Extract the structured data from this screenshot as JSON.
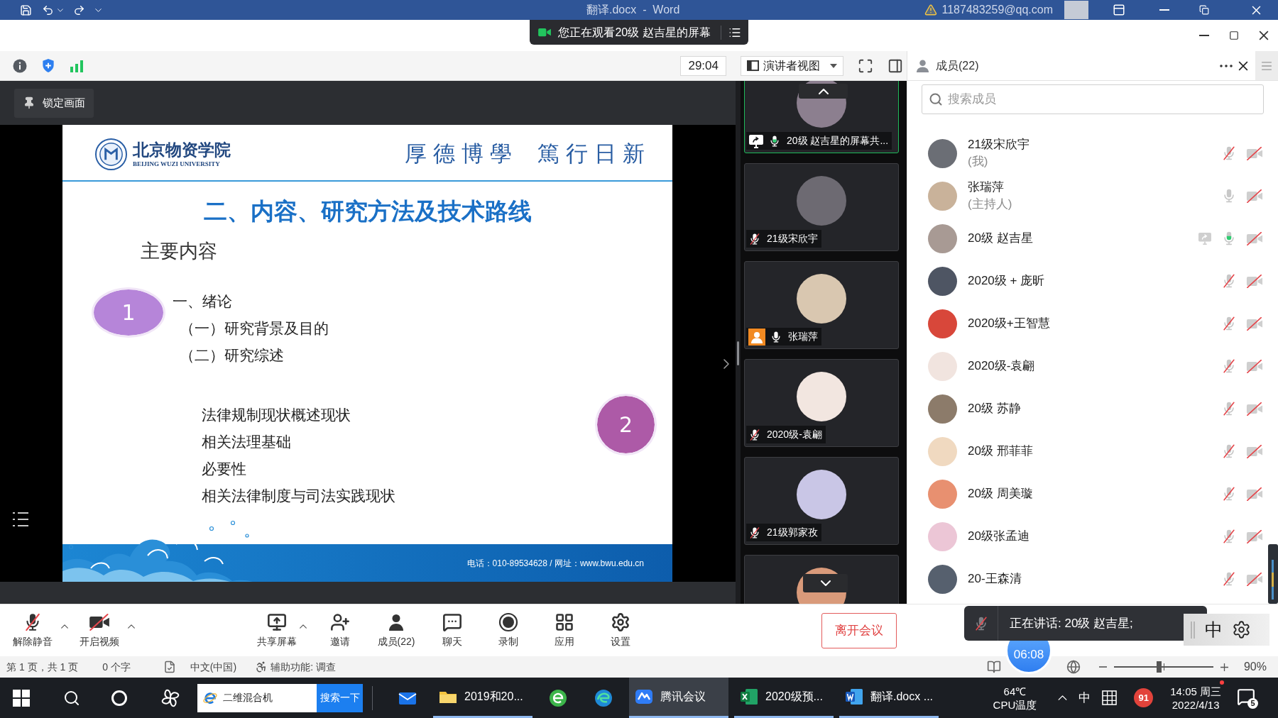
{
  "word_title_bar": {
    "title": "翻译.docx  -  Word",
    "account": "1187483259@qq.com"
  },
  "meeting": {
    "banner": "您正在观看20级 赵吉星的屏幕",
    "timer": "29:04",
    "view_mode": "演讲者视图",
    "members_header": "成员(22)",
    "lock_button": "锁定画面",
    "slide": {
      "school_name": "北京物资学院",
      "school_name_en": "BEIJING WUZI UNIVERSITY",
      "motto": "厚德博學 篤行日新",
      "title": "二、内容、研究方法及技术路线",
      "subtitle": "主要内容",
      "sections": [
        {
          "number": "1",
          "color": "#b685d9",
          "kind": "left",
          "items": [
            {
              "text": "一、绪论",
              "children": [
                {
                  "text": "（一）研究背景及目的"
                },
                {
                  "text": "（二）研究综述"
                }
              ]
            }
          ]
        },
        {
          "number": "2",
          "color": "#ad5aa7",
          "kind": "right",
          "items": [
            {
              "text": "法律规制现状概述现状"
            },
            {
              "text": "相关法理基础"
            },
            {
              "text": "必要性"
            },
            {
              "text": "相关法律制度与司法实践现状"
            }
          ]
        }
      ],
      "contact": "电话：010-89534628 / 网址：www.bwu.edu.cn"
    },
    "video_tiles": [
      {
        "name": "20级 赵吉星的屏幕共...",
        "sharing": true,
        "host": false,
        "muted": false,
        "speaking": true,
        "active": true
      },
      {
        "name": "21级宋欣宇",
        "sharing": false,
        "host": false,
        "muted": true,
        "speaking": false,
        "active": false
      },
      {
        "name": "张瑞萍",
        "sharing": false,
        "host": true,
        "muted": false,
        "speaking": false,
        "active": false
      },
      {
        "name": "2020级-袁翩",
        "sharing": false,
        "host": false,
        "muted": true,
        "speaking": false,
        "active": false
      },
      {
        "name": "21级郭家孜",
        "sharing": false,
        "host": false,
        "muted": true,
        "speaking": false,
        "active": false
      }
    ],
    "members_panel": {
      "search": {
        "placeholder": "搜索成员"
      },
      "members": [
        {
          "name": "21级宋欣宇",
          "role": "(我)",
          "sharing": false,
          "muted": true,
          "speaking": false,
          "video": false
        },
        {
          "name": "张瑞萍",
          "role": "(主持人)",
          "sharing": false,
          "muted": false,
          "speaking": false,
          "video": false
        },
        {
          "name": "20级 赵吉星",
          "sharing": true,
          "muted": false,
          "speaking": true,
          "video": false
        },
        {
          "name": "2020级 + 庞昕",
          "sharing": false,
          "muted": true,
          "speaking": false,
          "video": false
        },
        {
          "name": "2020级+王智慧",
          "sharing": false,
          "muted": true,
          "speaking": false,
          "video": false
        },
        {
          "name": "2020级-袁翩",
          "sharing": false,
          "muted": true,
          "speaking": false,
          "video": false
        },
        {
          "name": "20级 苏静",
          "sharing": false,
          "muted": true,
          "speaking": false,
          "video": false
        },
        {
          "name": "20级 邢菲菲",
          "sharing": false,
          "muted": true,
          "speaking": false,
          "video": false
        },
        {
          "name": "20级 周美璇",
          "sharing": false,
          "muted": true,
          "speaking": false,
          "video": false
        },
        {
          "name": "20级张孟迪",
          "sharing": false,
          "muted": true,
          "speaking": false,
          "video": false
        },
        {
          "name": "20-王森清",
          "sharing": false,
          "muted": true,
          "speaking": false,
          "video": false
        }
      ]
    },
    "toolbar_groups": [
      {
        "buttons": [
          {
            "kind": "mic",
            "label": "解除静音",
            "off": true,
            "menu": true
          },
          {
            "kind": "video",
            "label": "开启视频",
            "off": true,
            "menu": true
          }
        ]
      },
      {
        "buttons": [
          {
            "kind": "share",
            "label": "共享屏幕",
            "menu": true
          },
          {
            "kind": "invite",
            "label": "邀请",
            "menu": false
          },
          {
            "kind": "members",
            "label": "成员(22)",
            "menu": false
          },
          {
            "kind": "chat",
            "label": "聊天",
            "menu": false
          },
          {
            "kind": "record",
            "label": "录制",
            "menu": false
          },
          {
            "kind": "apps",
            "label": "应用",
            "menu": false
          },
          {
            "kind": "settings",
            "label": "设置",
            "menu": false
          }
        ]
      }
    ],
    "leave_button": "离开会议",
    "speaking_toast": "正在讲话: 20级 赵吉星;",
    "timer_bubble": "06:08"
  },
  "ime_bar": {
    "mode": "中"
  },
  "word_status_bar": {
    "page": "第 1 页，共 1 页",
    "words": "0 个字",
    "language": "中文(中国)",
    "accessibility": "辅助功能: 调查",
    "views": [
      {
        "kind": "read"
      },
      {
        "kind": "web"
      }
    ],
    "zoom": {
      "level": 0.45,
      "percent": "90%"
    }
  },
  "taskbar": {
    "search_box": {
      "value": "二维混合机",
      "button": "搜索一下"
    },
    "apps": [
      {
        "kind": "mail",
        "selected": false
      },
      {
        "kind": "folder",
        "label": "2019和20...",
        "selected": false
      },
      {
        "kind": "browser",
        "selected": false
      },
      {
        "kind": "edge",
        "selected": false
      },
      {
        "kind": "meeting",
        "label": "腾讯会议",
        "selected": true
      },
      {
        "kind": "excel",
        "label": "2020级预...",
        "selected": false
      },
      {
        "kind": "word",
        "label": "翻译.docx ...",
        "selected": false
      }
    ],
    "tray": {
      "temperature": "64℃",
      "temperature_label": "CPU温度",
      "ime": "中",
      "badge": "91",
      "time": "14:05 周三",
      "date": "2022/4/13",
      "notifications": "5"
    }
  }
}
